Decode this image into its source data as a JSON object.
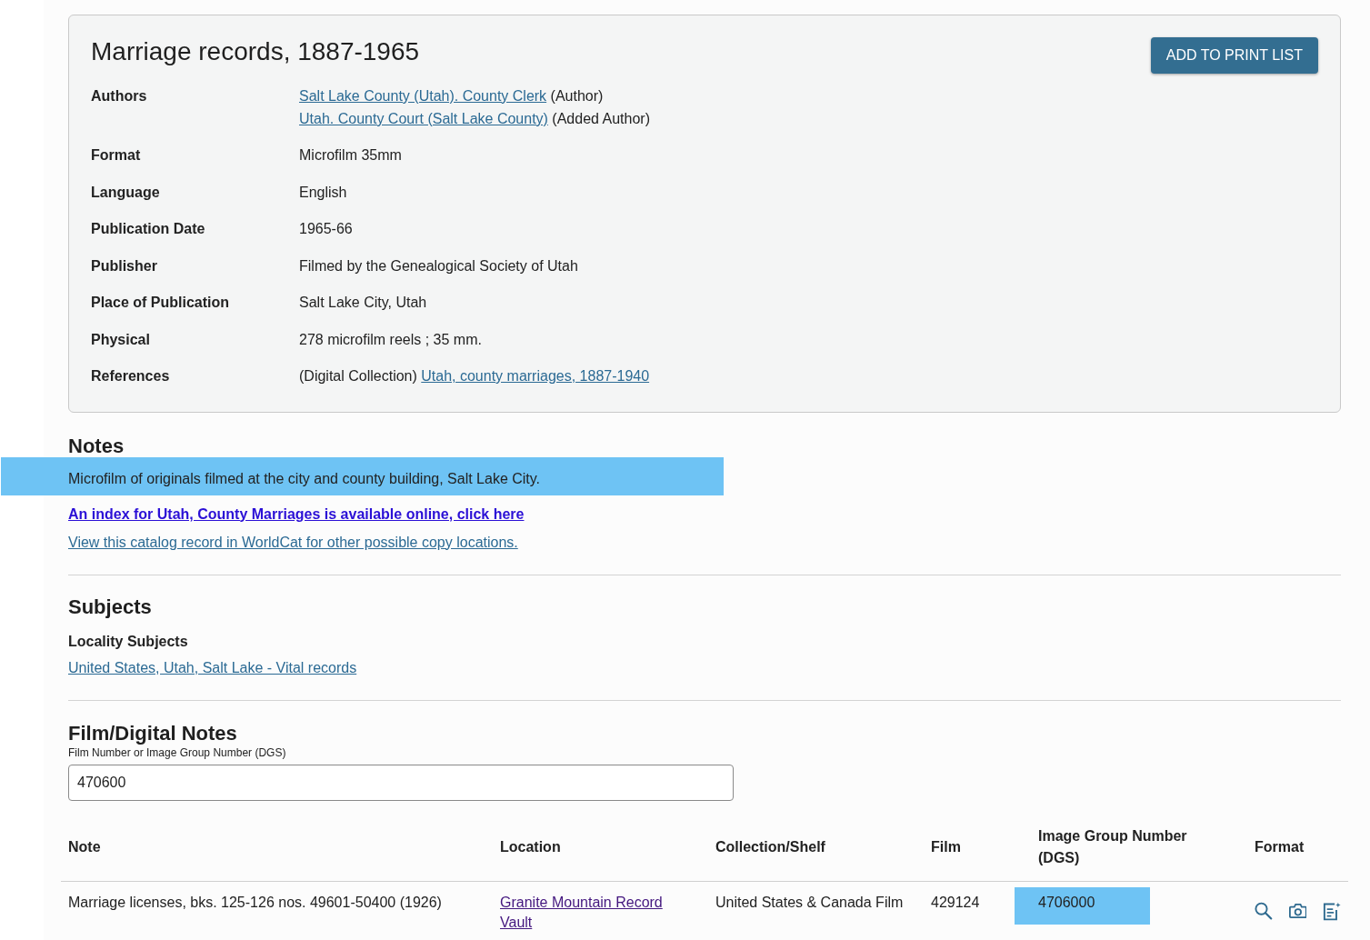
{
  "record": {
    "title": "Marriage records, 1887-1965",
    "print_button": "ADD TO PRINT LIST",
    "fields": [
      {
        "label": "Authors",
        "lines": [
          [
            {
              "kind": "link",
              "text": "Salt Lake County (Utah). County Clerk"
            },
            {
              "kind": "text",
              "text": "(Author)"
            }
          ],
          [
            {
              "kind": "link",
              "text": "Utah. County Court (Salt Lake County)"
            },
            {
              "kind": "text",
              "text": "(Added Author)"
            }
          ]
        ]
      },
      {
        "label": "Format",
        "lines": [
          [
            {
              "kind": "text",
              "text": "Microfilm 35mm"
            }
          ]
        ]
      },
      {
        "label": "Language",
        "lines": [
          [
            {
              "kind": "text",
              "text": "English"
            }
          ]
        ]
      },
      {
        "label": "Publication Date",
        "lines": [
          [
            {
              "kind": "text",
              "text": "1965-66"
            }
          ]
        ]
      },
      {
        "label": "Publisher",
        "lines": [
          [
            {
              "kind": "text",
              "text": "Filmed by the Genealogical Society of Utah"
            }
          ]
        ]
      },
      {
        "label": "Place of Publication",
        "lines": [
          [
            {
              "kind": "text",
              "text": "Salt Lake City, Utah"
            }
          ]
        ]
      },
      {
        "label": "Physical",
        "lines": [
          [
            {
              "kind": "text",
              "text": "278 microfilm reels ; 35 mm."
            }
          ]
        ]
      },
      {
        "label": "References",
        "lines": [
          [
            {
              "kind": "text",
              "text": "(Digital Collection)"
            },
            {
              "kind": "link",
              "text": "Utah, county marriages, 1887-1940"
            }
          ]
        ]
      }
    ]
  },
  "notes": {
    "heading": "Notes",
    "items": [
      {
        "kind": "text",
        "text": "Microfilm of originals filmed at the city and county building, Salt Lake City.",
        "highlighted": true
      },
      {
        "kind": "bold_link",
        "text": "An index for Utah, County Marriages is available online, click here",
        "highlighted": false
      },
      {
        "kind": "link",
        "text": "View this catalog record in WorldCat for other possible copy locations.",
        "highlighted": false
      }
    ]
  },
  "subjects": {
    "heading": "Subjects",
    "groups": [
      {
        "title": "Locality Subjects",
        "links": [
          "United States, Utah, Salt Lake - Vital records"
        ]
      }
    ]
  },
  "film_notes": {
    "heading": "Film/Digital Notes",
    "search": {
      "label": "Film Number or Image Group Number (DGS)",
      "value": "470600"
    },
    "table": {
      "columns": [
        "Note",
        "Location",
        "Collection/Shelf",
        "Film",
        "Image Group Number (DGS)",
        "Format"
      ],
      "rows": [
        {
          "cells": [
            {
              "kind": "text",
              "text": "Marriage licenses, bks. 125-126 nos. 49601-50400 (1926)",
              "highlighted": false
            },
            {
              "kind": "visited_link",
              "text": "Granite Mountain Record Vault",
              "highlighted": false
            },
            {
              "kind": "text",
              "text": "United States & Canada Film",
              "highlighted": false
            },
            {
              "kind": "text",
              "text": "429124",
              "highlighted": false
            },
            {
              "kind": "text",
              "text": "4706000",
              "highlighted": true
            },
            {
              "kind": "format_actions",
              "highlighted": false
            }
          ]
        }
      ]
    }
  }
}
